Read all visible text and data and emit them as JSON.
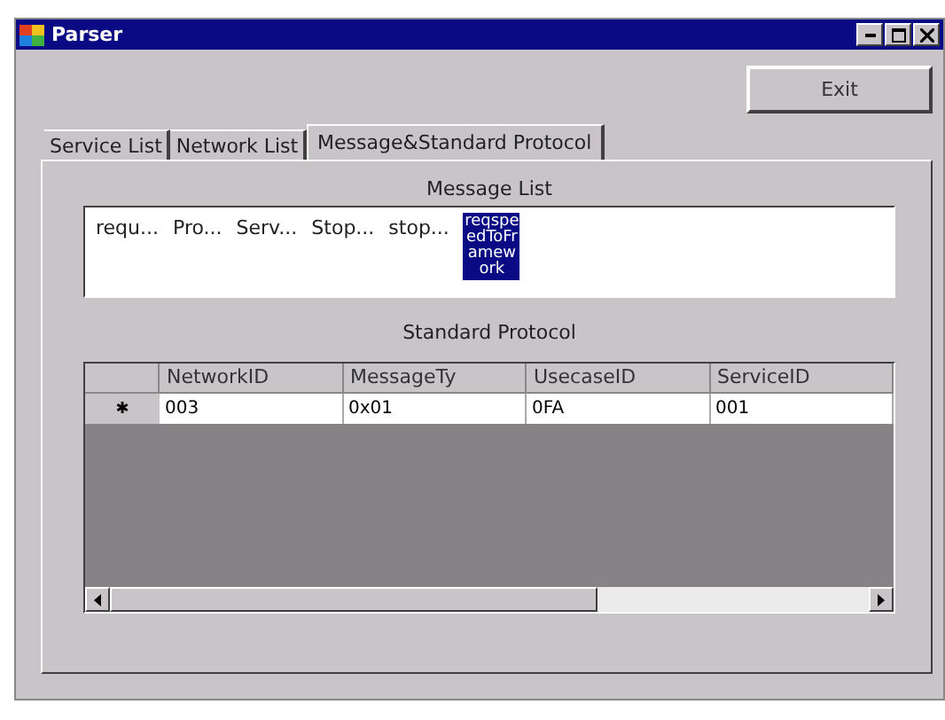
{
  "window": {
    "title": "Parser"
  },
  "exit_button": {
    "label": "Exit"
  },
  "tabs": [
    {
      "label": "Service List",
      "selected": false
    },
    {
      "label": "Network List",
      "selected": false
    },
    {
      "label": "Message&Standard Protocol",
      "selected": true
    }
  ],
  "message_list": {
    "title": "Message List",
    "items": [
      {
        "label": "requ...",
        "selected": false
      },
      {
        "label": "Pro...",
        "selected": false
      },
      {
        "label": "Serv...",
        "selected": false
      },
      {
        "label": "Stop...",
        "selected": false
      },
      {
        "label": "stop...",
        "selected": false
      },
      {
        "label": "reqspeedToFramework",
        "selected": true
      }
    ]
  },
  "standard_protocol": {
    "title": "Standard Protocol",
    "columns": [
      "NetworkID",
      "MessageTy",
      "UsecaseID",
      "ServiceID"
    ],
    "rows": [
      {
        "marker": "✱",
        "cells": [
          "003",
          "0x01",
          "0FA",
          "001"
        ]
      }
    ]
  }
}
